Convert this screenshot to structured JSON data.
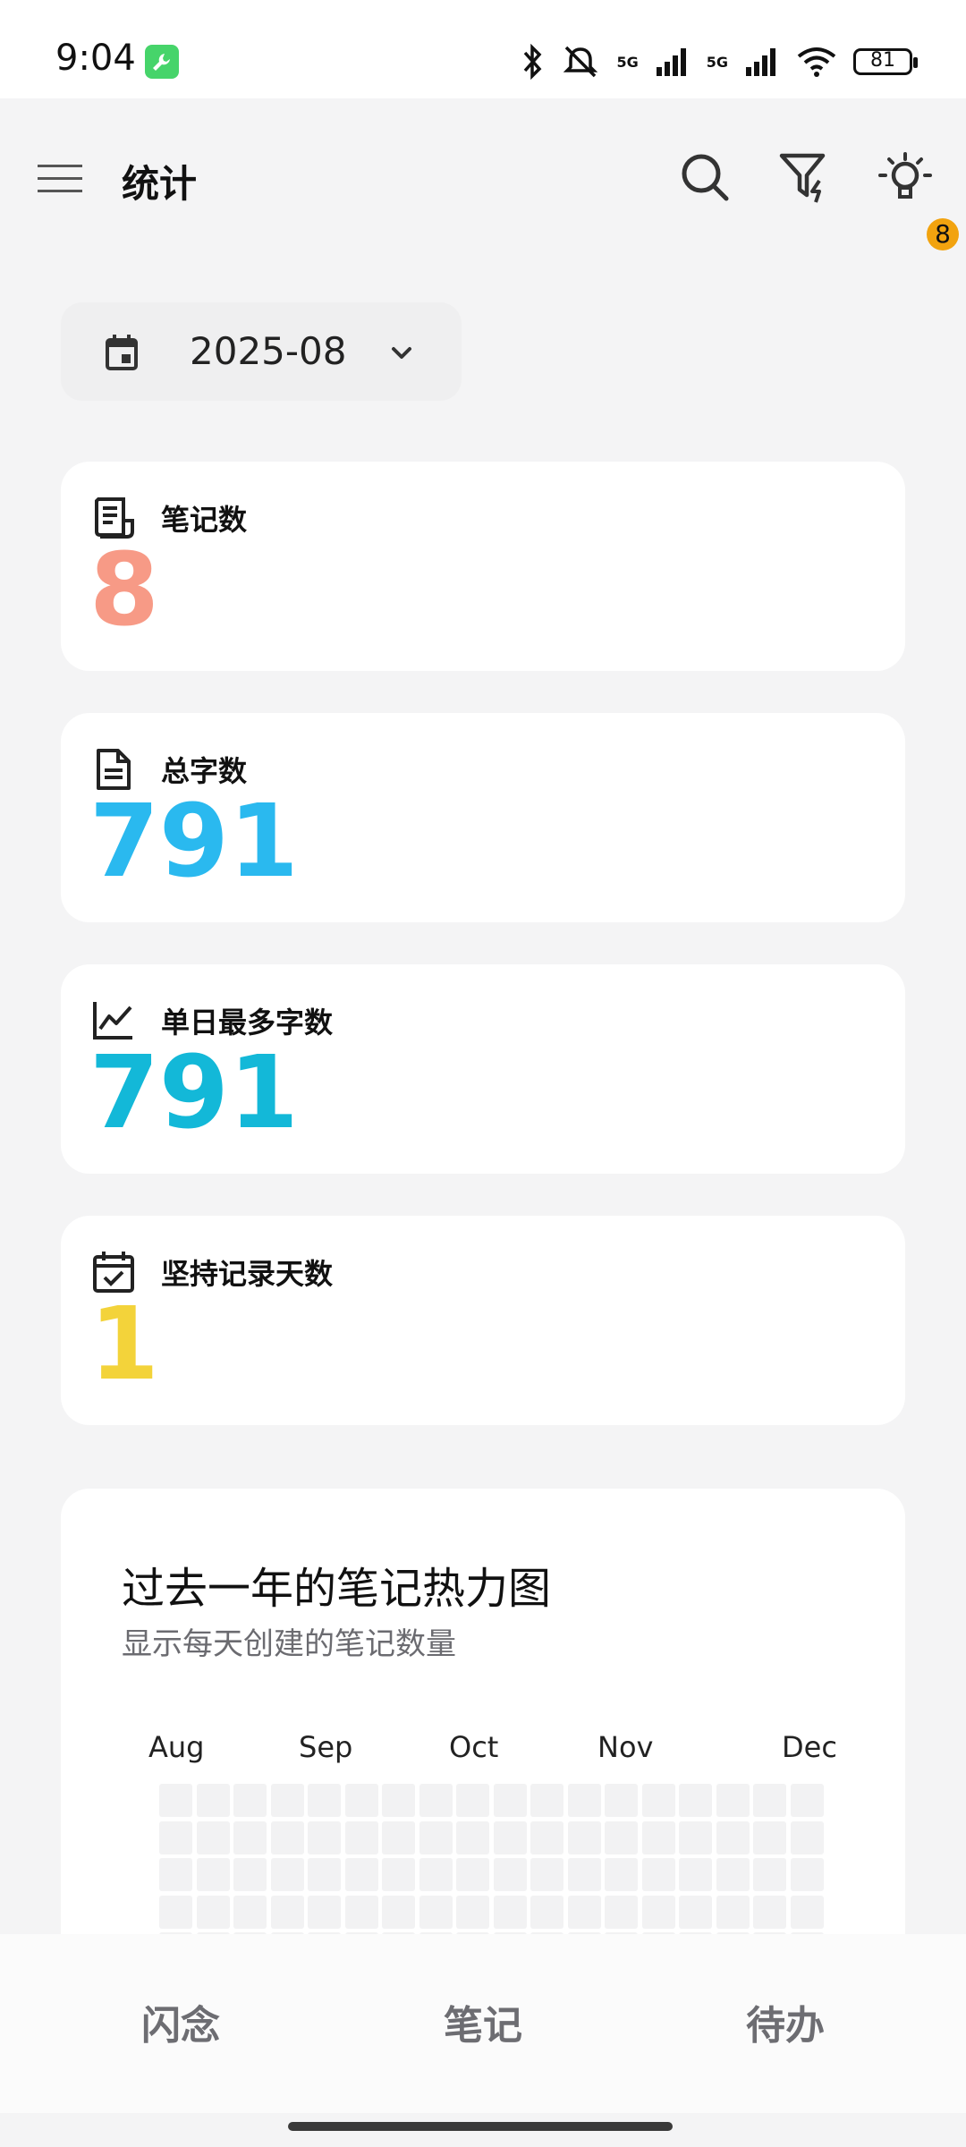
{
  "status_bar": {
    "time": "9:04",
    "network_1": "5G",
    "network_2": "5G",
    "battery": "81"
  },
  "app_bar": {
    "title": "统计",
    "notification_count": "8"
  },
  "month_selector": {
    "value": "2025-08"
  },
  "stats": [
    {
      "label": "笔记数",
      "value": "8",
      "color": "#f79a86",
      "icon": "document-list-icon"
    },
    {
      "label": "总字数",
      "value": "791",
      "color": "#2ab9ef",
      "icon": "document-icon"
    },
    {
      "label": "单日最多字数",
      "value": "791",
      "color": "#13b8d8",
      "icon": "chart-line-icon"
    },
    {
      "label": "坚持记录天数",
      "value": "1",
      "color": "#f3d33a",
      "icon": "calendar-check-icon"
    }
  ],
  "heatmap": {
    "title": "过去一年的笔记热力图",
    "subtitle": "显示每天创建的笔记数量",
    "months": [
      "Aug",
      "Sep",
      "Oct",
      "Nov",
      "Dec"
    ]
  },
  "bottom_nav": {
    "items": [
      {
        "label": "闪念"
      },
      {
        "label": "笔记"
      },
      {
        "label": "待办"
      }
    ]
  }
}
